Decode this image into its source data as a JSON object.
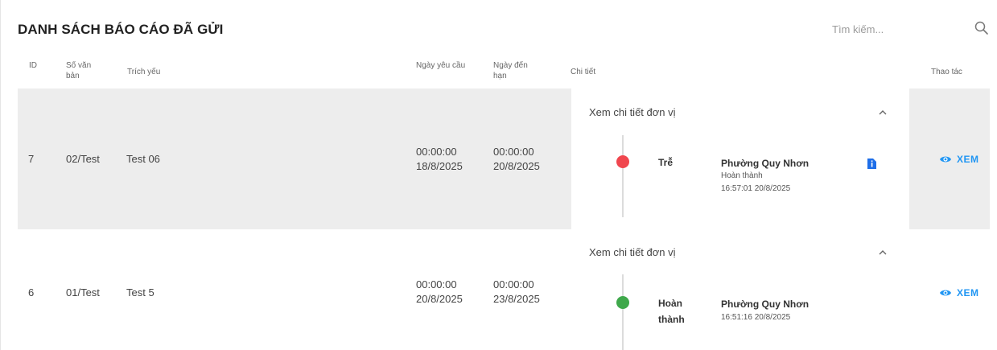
{
  "page": {
    "title": "DANH SÁCH BÁO CÁO ĐÃ GỬI"
  },
  "search": {
    "placeholder": "Tìm kiếm...",
    "icon": "search-icon"
  },
  "columns": {
    "id": "ID",
    "so_van_ban": [
      "Số văn",
      "bản"
    ],
    "trich_yeu": "Trích yếu",
    "ngay_yeu_cau": "Ngày yêu cầu",
    "ngay_den_han": [
      "Ngày đến",
      "hạn"
    ],
    "chi_tiet": "Chi tiết",
    "thao_tac": "Thao tác"
  },
  "rows": [
    {
      "id": "7",
      "so_van_ban": "02/Test",
      "trich_yeu": "Test 06",
      "ngay_yeu_cau": [
        "00:00:00",
        "18/8/2025"
      ],
      "ngay_den_han": [
        "00:00:00",
        "20/8/2025"
      ],
      "detail": {
        "header": "Xem chi tiết đơn vị",
        "status": [
          "Trễ"
        ],
        "status_color": "#f0464e",
        "unit": "Phường Quy Nhơn",
        "sub_status": "Hoàn thành",
        "time": "16:57:01 20/8/2025",
        "has_file": true
      },
      "action": "XEM"
    },
    {
      "id": "6",
      "so_van_ban": "01/Test",
      "trich_yeu": "Test 5",
      "ngay_yeu_cau": [
        "00:00:00",
        "20/8/2025"
      ],
      "ngay_den_han": [
        "00:00:00",
        "23/8/2025"
      ],
      "detail": {
        "header": "Xem chi tiết đơn vị",
        "status": [
          "Hoàn",
          "thành"
        ],
        "status_color": "#3fa84b",
        "unit": "Phường Quy Nhơn",
        "time": "16:51:16 20/8/2025",
        "has_file": false
      },
      "action": "XEM"
    }
  ],
  "colors": {
    "accent": "#2196f3",
    "row_highlight": "#ededed",
    "late": "#f0464e",
    "done": "#3fa84b"
  }
}
